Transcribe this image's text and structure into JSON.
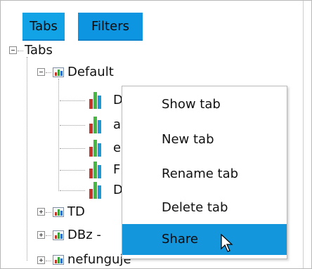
{
  "tabbar": {
    "tabs": [
      {
        "label": "Tabs"
      },
      {
        "label": "Filters"
      }
    ]
  },
  "tree": {
    "root": {
      "label": "Tabs",
      "expanded": true
    },
    "groups": [
      {
        "label": "Default",
        "expanded": true,
        "children": [
          {
            "label": "D"
          },
          {
            "label": "a"
          },
          {
            "label": "e"
          },
          {
            "label": "F"
          },
          {
            "label": "D"
          }
        ]
      },
      {
        "label": "TD",
        "expanded": false
      },
      {
        "label": "DBz -",
        "expanded": false
      },
      {
        "label": "nefunguje",
        "expanded": false
      }
    ]
  },
  "context_menu": {
    "items": [
      {
        "label": "Show tab"
      },
      {
        "label": "New tab"
      },
      {
        "label": "Rename tab"
      },
      {
        "label": "Delete tab"
      },
      {
        "label": "Share",
        "highlighted": true
      }
    ]
  },
  "colors": {
    "tab_active": "#12a2e6",
    "menu_highlight": "#1496dd"
  }
}
